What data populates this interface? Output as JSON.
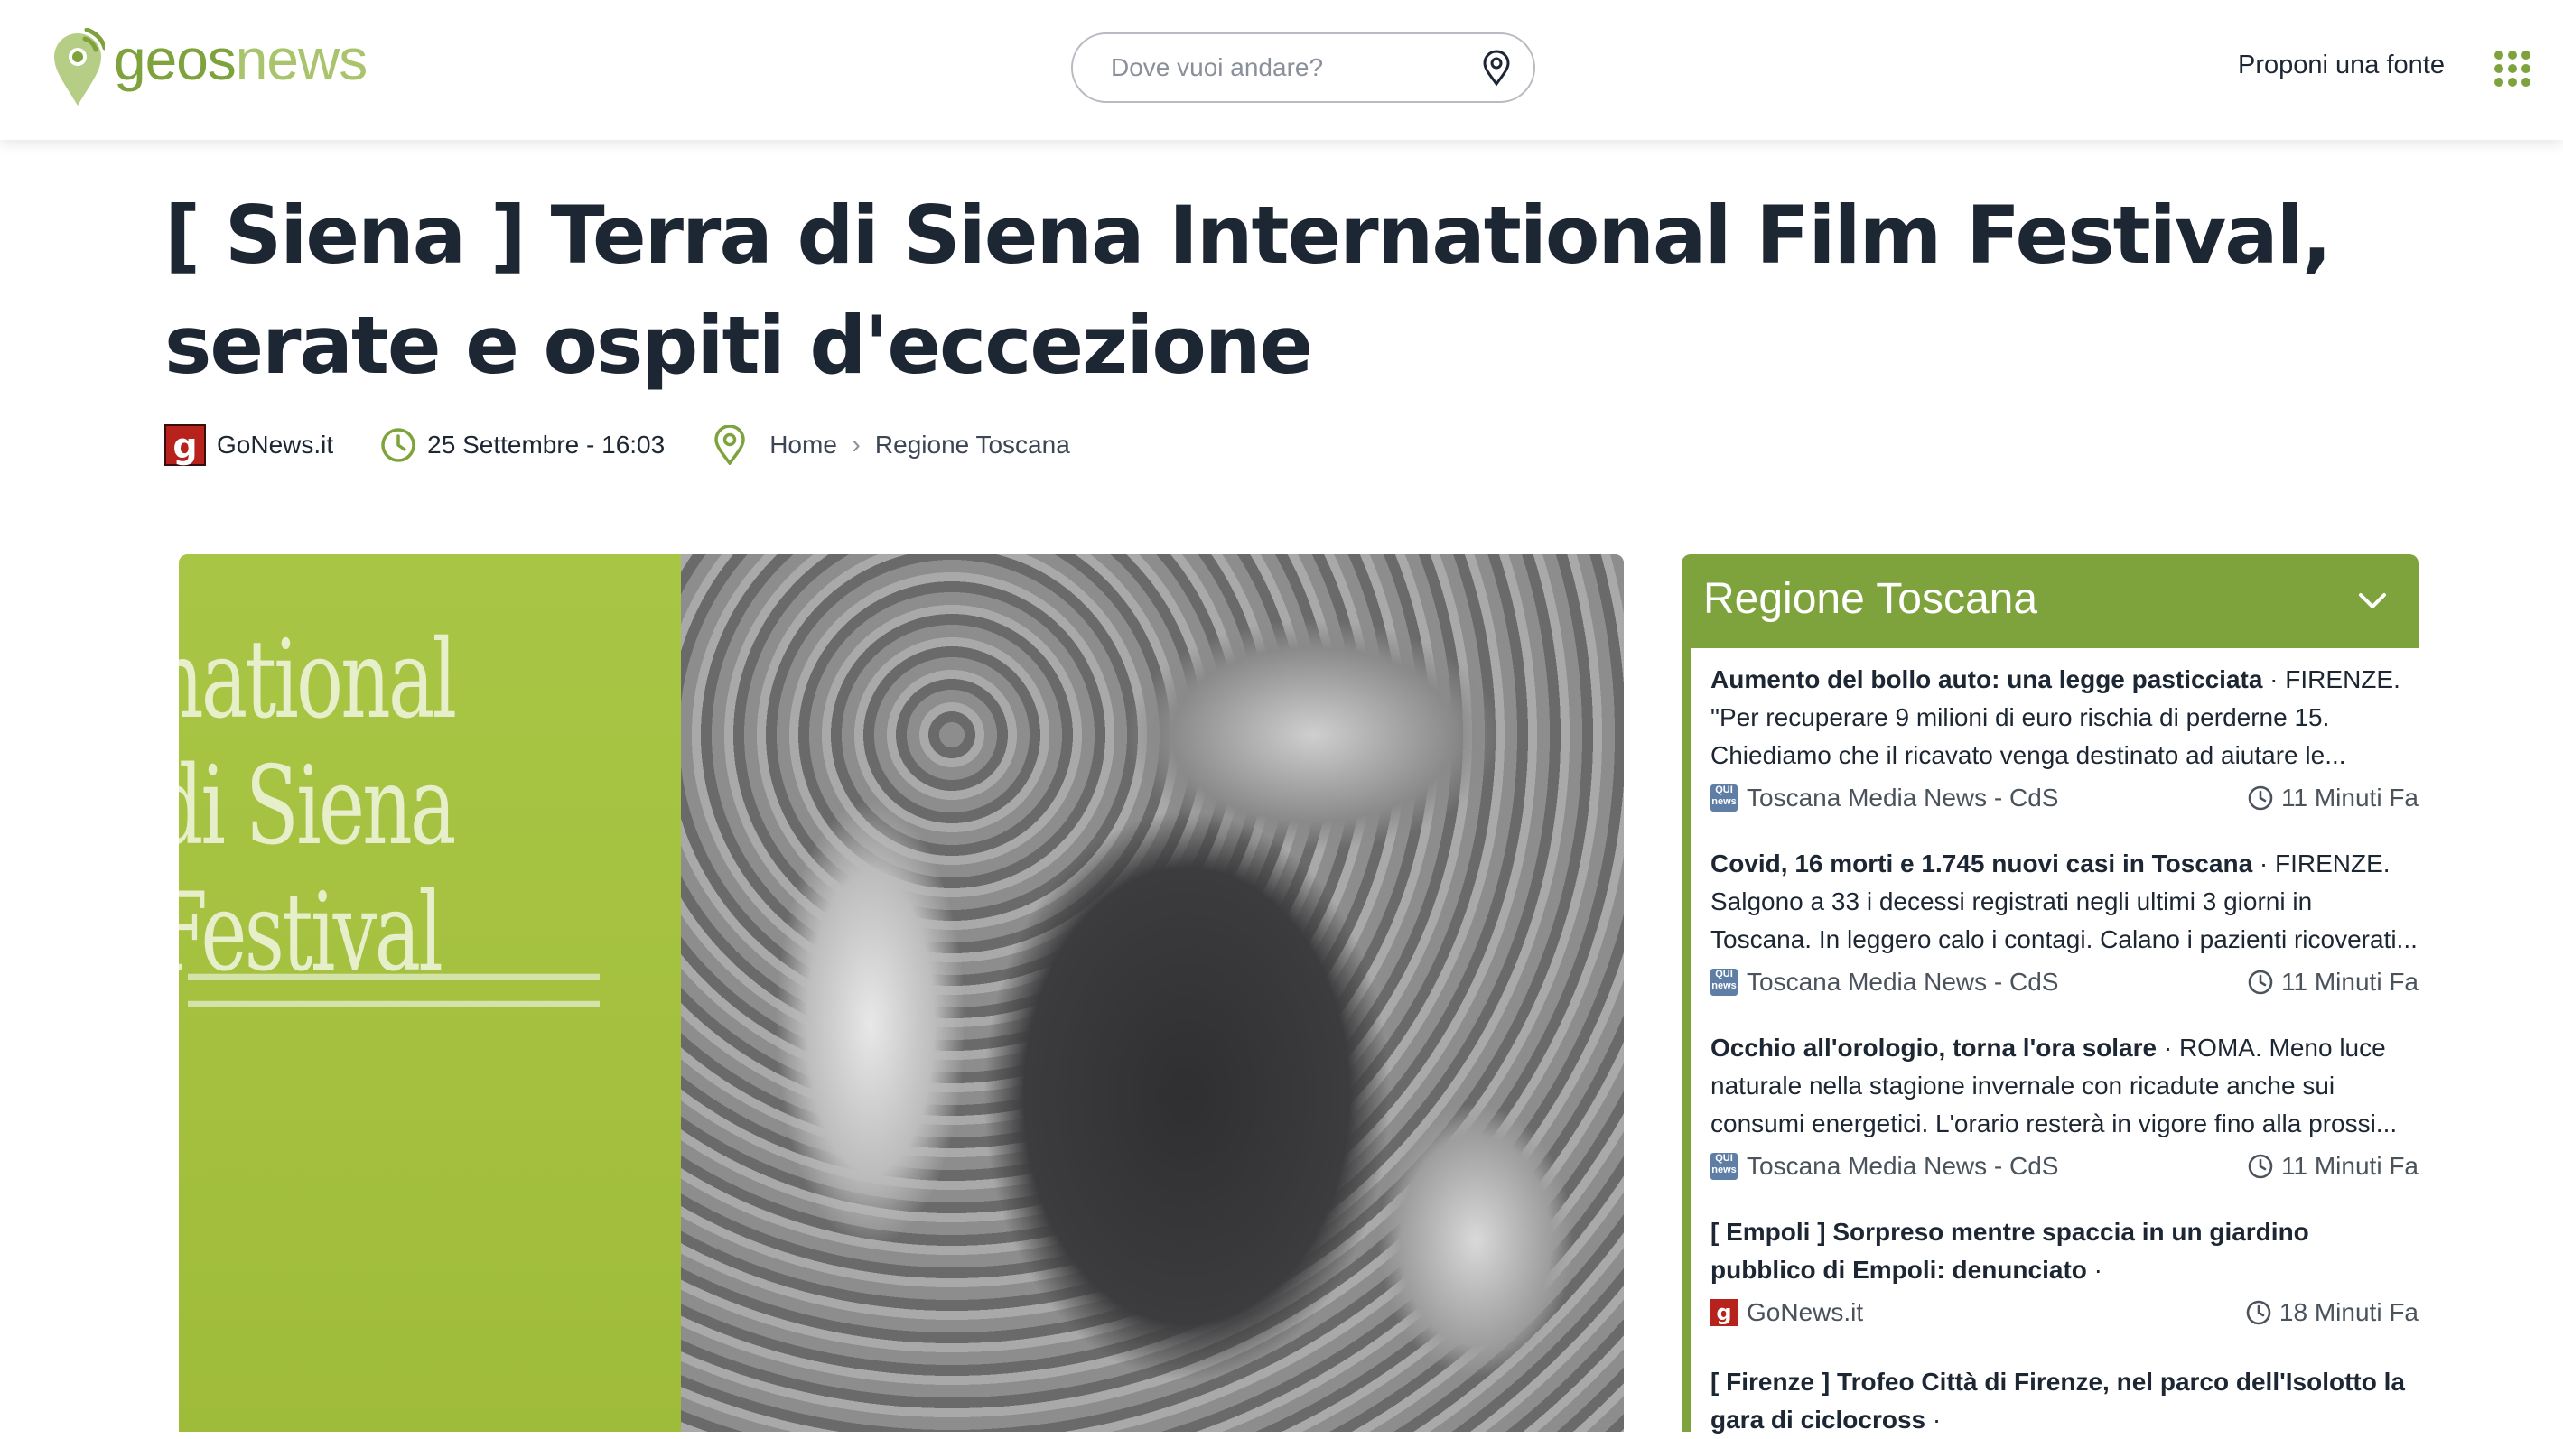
{
  "header": {
    "logo_part1": "geos",
    "logo_part2": "news",
    "search_placeholder": "Dove vuoi andare?",
    "propose_label": "Proponi una fonte",
    "brand_color": "#7ea33d"
  },
  "article": {
    "title": "[ Siena ] Terra di Siena International Film Festival, serate e ospiti d'eccezione",
    "source_icon_letter": "g",
    "source": "GoNews.it",
    "date": "25 Settembre - 16:03",
    "breadcrumb": [
      "Home",
      "Regione Toscana"
    ],
    "image_text_lines": [
      "national",
      "di Siena",
      "Festival"
    ]
  },
  "sidebar": {
    "title": "Regione Toscana",
    "news": [
      {
        "headline": "Aumento del bollo auto: una legge pasticciata",
        "excerpt": " · FIRENZE. \"Per recuperare 9 milioni di euro rischia di perderne 15. Chiediamo che il ricavato venga destinato ad aiutare le...",
        "source": "Toscana Media News - CdS",
        "time": "11 Minuti Fa",
        "icon": "qui-news-icon"
      },
      {
        "headline": "Covid, 16 morti e 1.745 nuovi casi in Toscana",
        "excerpt": " · FIRENZE. Salgono a 33 i decessi registrati negli ultimi 3 giorni in Toscana. In leggero calo i contagi. Calano i pazienti ricoverati...",
        "source": "Toscana Media News - CdS",
        "time": "11 Minuti Fa",
        "icon": "qui-news-icon"
      },
      {
        "headline": "Occhio all'orologio, torna l'ora solare",
        "excerpt": " · ROMA. Meno luce naturale nella stagione invernale con ricadute anche sui consumi energetici. L'orario resterà in vigore fino alla prossi...",
        "source": "Toscana Media News - CdS",
        "time": "11 Minuti Fa",
        "icon": "qui-news-icon"
      },
      {
        "headline": "[ Empoli ] Sorpreso mentre spaccia in un giardino pubblico di Empoli: denunciato",
        "excerpt": " ·",
        "source": "GoNews.it",
        "time": "18 Minuti Fa",
        "icon": "gonews-icon"
      },
      {
        "headline": "[ Firenze ] Trofeo Città di Firenze, nel parco dell'Isolotto la gara di ciclocross",
        "excerpt": " ·",
        "source": "",
        "time": "",
        "icon": ""
      }
    ]
  }
}
